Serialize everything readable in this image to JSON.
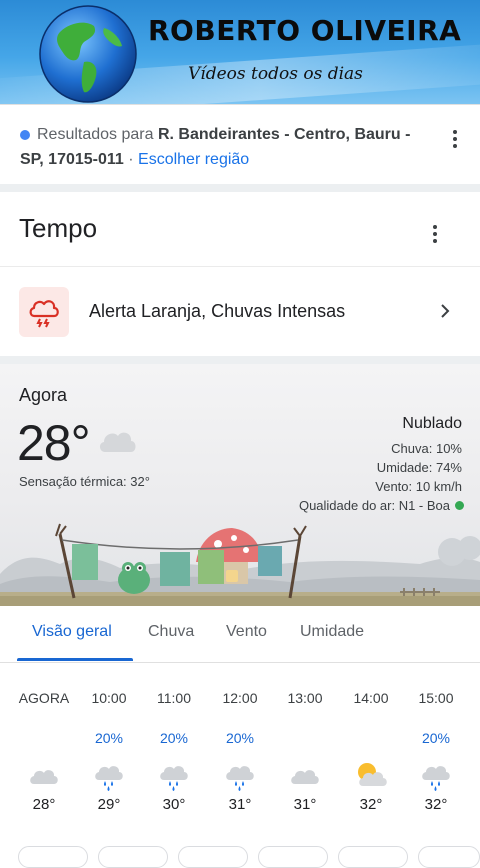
{
  "banner": {
    "title": "ROBERTO OLIVEIRA",
    "subtitle": "Vídeos todos os dias"
  },
  "location": {
    "prefix": "Resultados para ",
    "place_part1": "R. Bandeirantes - Centro, Bauru -",
    "place_part2": "SP, 17015-011",
    "separator": " · ",
    "change_link": "Escolher região"
  },
  "weather_card": {
    "title": "Tempo",
    "alert_text": "Alerta Laranja, Chuvas Intensas",
    "now_label": "Agora",
    "temperature": "28°",
    "feels_like": "Sensação térmica: 32°",
    "condition": "Nublado",
    "precip": "Chuva: 10%",
    "humidity": "Umidade: 74%",
    "wind": "Vento: 10 km/h",
    "air_quality": "Qualidade do ar: N1 - Boa",
    "colors": {
      "air_quality_good": "#34a853",
      "alert_bg": "#fce8e6",
      "alert_red": "#d93025",
      "accent": "#1967d2"
    }
  },
  "tabs": [
    "Visão geral",
    "Chuva",
    "Vento",
    "Umidade"
  ],
  "hourly": [
    {
      "time": "AGORA",
      "pct": "",
      "icon": "cloudy-icon",
      "temp": "28°"
    },
    {
      "time": "10:00",
      "pct": "20%",
      "icon": "rain-icon",
      "temp": "29°"
    },
    {
      "time": "11:00",
      "pct": "20%",
      "icon": "rain-icon",
      "temp": "30°"
    },
    {
      "time": "12:00",
      "pct": "20%",
      "icon": "rain-icon",
      "temp": "31°"
    },
    {
      "time": "13:00",
      "pct": "",
      "icon": "cloudy-icon",
      "temp": "31°"
    },
    {
      "time": "14:00",
      "pct": "",
      "icon": "partly-sunny-icon",
      "temp": "32°"
    },
    {
      "time": "15:00",
      "pct": "20%",
      "icon": "rain-icon",
      "temp": "32°"
    }
  ]
}
